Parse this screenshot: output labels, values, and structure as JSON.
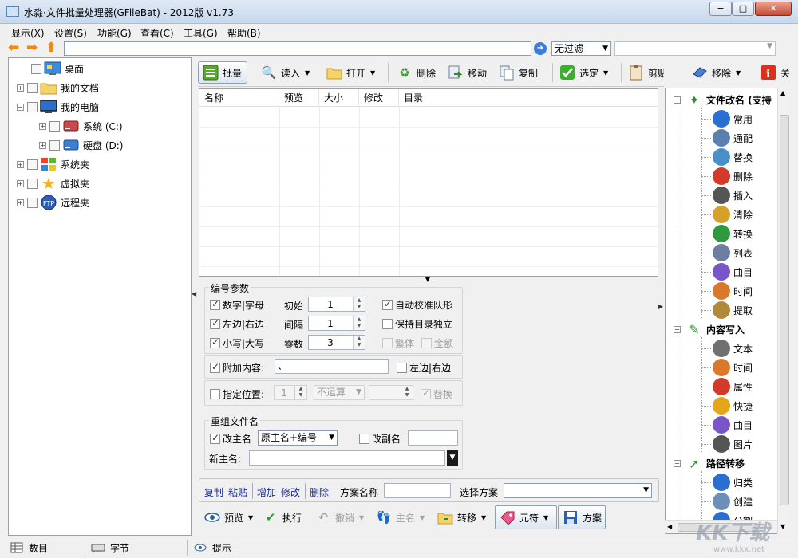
{
  "window": {
    "title": "水淼·文件批量处理器(GFileBat) - 2012版 v1.73",
    "minimize": "−",
    "maximize": "□",
    "close": "✕"
  },
  "menu": [
    "显示(X)",
    "设置(S)",
    "功能(G)",
    "查看(C)",
    "工具(G)",
    "帮助(B)"
  ],
  "address": {
    "path": "",
    "filter": "无过滤"
  },
  "tree": [
    {
      "label": "桌面",
      "icon": "desktop-icon"
    },
    {
      "label": "我的文档",
      "icon": "folder-icon"
    },
    {
      "label": "我的电脑",
      "icon": "computer-icon"
    },
    {
      "label": "系统 (C:)",
      "icon": "drive-icon"
    },
    {
      "label": "硬盘 (D:)",
      "icon": "drive-icon"
    },
    {
      "label": "系统夹",
      "icon": "windows-icon"
    },
    {
      "label": "虚拟夹",
      "icon": "star-icon"
    },
    {
      "label": "远程夹",
      "icon": "ftp-icon"
    }
  ],
  "toolbar": [
    "批量",
    "读入",
    "打开",
    "删除",
    "移动",
    "复制",
    "选定",
    "剪贴",
    "移除",
    "关"
  ],
  "list": {
    "columns": [
      "名称",
      "预览",
      "大小",
      "修改",
      "目录"
    ]
  },
  "numbering": {
    "title": "编号参数",
    "digits_letters": "数字|字母",
    "left_right": "左边|右边",
    "lower_upper": "小写|大写",
    "start_label": "初始",
    "start_value": "1",
    "step_label": "间隔",
    "step_value": "1",
    "zeros_label": "零数",
    "zeros_value": "3",
    "auto_align": "自动校准队形",
    "keep_dir": "保持目录独立",
    "traditional": "繁体",
    "amount": "金额"
  },
  "append": {
    "label": "附加内容:",
    "value": "、",
    "left_right": "左边|右边"
  },
  "position": {
    "label": "指定位置:",
    "value": "1",
    "op": "不运算",
    "replace": "替换"
  },
  "rename": {
    "title": "重组文件名",
    "main_name": "改主名",
    "main_mode": "原主名+编号",
    "ext_name": "改副名",
    "new_name_label": "新主名:"
  },
  "scheme": {
    "copy": "复制",
    "paste": "粘贴",
    "add": "增加",
    "edit": "修改",
    "delete": "删除",
    "name_label": "方案名称",
    "select_label": "选择方案"
  },
  "actions": [
    "预览",
    "执行",
    "撤销",
    "主名",
    "转移",
    "元符",
    "方案"
  ],
  "right_tree": [
    {
      "label": "文件改名 (支持",
      "group": true,
      "icon": "rename-icon"
    },
    {
      "label": "常用",
      "icon": "info-icon",
      "color": "#2a6fcf"
    },
    {
      "label": "通配",
      "icon": "wildcard-icon",
      "color": "#5a7fb0"
    },
    {
      "label": "替换",
      "icon": "replace-icon",
      "color": "#4a90c8"
    },
    {
      "label": "删除",
      "icon": "delete-icon",
      "color": "#d23a2a"
    },
    {
      "label": "插入",
      "icon": "insert-icon",
      "color": "#555555"
    },
    {
      "label": "清除",
      "icon": "broom-icon",
      "color": "#d6a12a"
    },
    {
      "label": "转换",
      "icon": "convert-icon",
      "color": "#2f9a3c"
    },
    {
      "label": "列表",
      "icon": "list-icon",
      "color": "#6c7fa0"
    },
    {
      "label": "曲目",
      "icon": "music-icon",
      "color": "#7a55c8"
    },
    {
      "label": "时间",
      "icon": "clock-icon",
      "color": "#d9772a"
    },
    {
      "label": "提取",
      "icon": "extract-icon",
      "color": "#b08a3a"
    },
    {
      "label": "内容写入",
      "group": true,
      "icon": "pen-icon"
    },
    {
      "label": "文本",
      "icon": "text-icon",
      "color": "#707070"
    },
    {
      "label": "时间",
      "icon": "clock-icon",
      "color": "#d9772a"
    },
    {
      "label": "属性",
      "icon": "hand-icon",
      "color": "#d23a2a"
    },
    {
      "label": "快捷",
      "icon": "shortcut-icon",
      "color": "#e3a51a"
    },
    {
      "label": "曲目",
      "icon": "music-icon",
      "color": "#7a55c8"
    },
    {
      "label": "图片",
      "icon": "image-icon",
      "color": "#555555"
    },
    {
      "label": "路径转移",
      "group": true,
      "icon": "pin-icon"
    },
    {
      "label": "归类",
      "icon": "classify-icon",
      "color": "#2a6fcf"
    },
    {
      "label": "创建",
      "icon": "create-icon",
      "color": "#6c8fb8"
    },
    {
      "label": "分割",
      "icon": "split-icon",
      "color": "#2a6fcf"
    }
  ],
  "status": [
    "数目",
    "字节",
    "提示"
  ],
  "watermark": {
    "text": "KK下载",
    "url": "www.kkx.net"
  }
}
